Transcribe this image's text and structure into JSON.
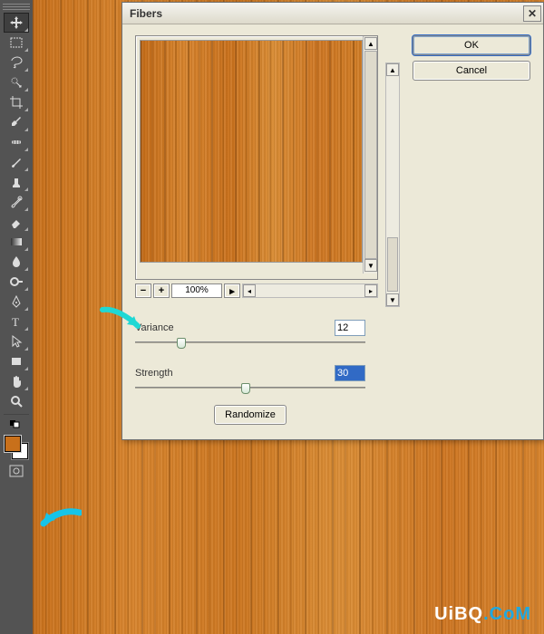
{
  "dialog": {
    "title": "Fibers",
    "ok_label": "OK",
    "cancel_label": "Cancel",
    "zoom_value": "100%",
    "variance": {
      "label": "Variance",
      "value": "12",
      "slider_percent": 18
    },
    "strength": {
      "label": "Strength",
      "value": "30",
      "slider_percent": 46
    },
    "randomize_label": "Randomize"
  },
  "colors": {
    "foreground": "#C8701B",
    "background": "#FFFFFF"
  },
  "watermark": {
    "part1": "UiBQ",
    "part2": ".CoM"
  }
}
